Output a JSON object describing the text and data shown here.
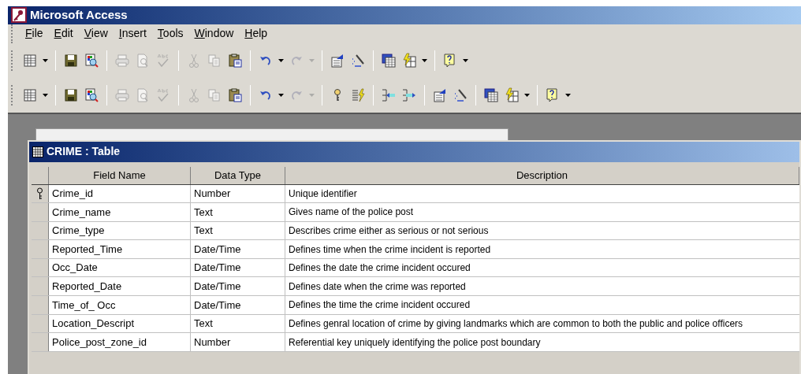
{
  "window": {
    "title": "Microsoft Access"
  },
  "menu": [
    "File",
    "Edit",
    "View",
    "Insert",
    "Tools",
    "Window",
    "Help"
  ],
  "toolbars": [
    [
      {
        "kind": "view",
        "dropdown": true,
        "disabled": false
      },
      {
        "kind": "separator"
      },
      {
        "kind": "save",
        "dropdown": false,
        "disabled": false
      },
      {
        "kind": "file-search",
        "dropdown": false,
        "disabled": false
      },
      {
        "kind": "separator"
      },
      {
        "kind": "print",
        "dropdown": false,
        "disabled": true
      },
      {
        "kind": "preview",
        "dropdown": false,
        "disabled": true
      },
      {
        "kind": "spelling",
        "dropdown": false,
        "disabled": true
      },
      {
        "kind": "separator"
      },
      {
        "kind": "cut",
        "dropdown": false,
        "disabled": true
      },
      {
        "kind": "copy",
        "dropdown": false,
        "disabled": true
      },
      {
        "kind": "paste",
        "dropdown": false,
        "disabled": false
      },
      {
        "kind": "separator"
      },
      {
        "kind": "undo",
        "dropdown": true,
        "disabled": false
      },
      {
        "kind": "redo",
        "dropdown": true,
        "disabled": true
      },
      {
        "kind": "separator"
      },
      {
        "kind": "properties",
        "dropdown": false,
        "disabled": false
      },
      {
        "kind": "build",
        "dropdown": false,
        "disabled": false
      },
      {
        "kind": "separator"
      },
      {
        "kind": "database",
        "dropdown": false,
        "disabled": false
      },
      {
        "kind": "new-object",
        "dropdown": true,
        "disabled": false
      },
      {
        "kind": "separator"
      },
      {
        "kind": "help",
        "dropdown": true,
        "disabled": false
      }
    ],
    [
      {
        "kind": "view",
        "dropdown": true,
        "disabled": false
      },
      {
        "kind": "separator"
      },
      {
        "kind": "save",
        "dropdown": false,
        "disabled": false
      },
      {
        "kind": "file-search",
        "dropdown": false,
        "disabled": false
      },
      {
        "kind": "separator"
      },
      {
        "kind": "print",
        "dropdown": false,
        "disabled": true
      },
      {
        "kind": "preview",
        "dropdown": false,
        "disabled": true
      },
      {
        "kind": "spelling",
        "dropdown": false,
        "disabled": true
      },
      {
        "kind": "separator"
      },
      {
        "kind": "cut",
        "dropdown": false,
        "disabled": true
      },
      {
        "kind": "copy",
        "dropdown": false,
        "disabled": true
      },
      {
        "kind": "paste",
        "dropdown": false,
        "disabled": false
      },
      {
        "kind": "separator"
      },
      {
        "kind": "undo",
        "dropdown": true,
        "disabled": false
      },
      {
        "kind": "redo",
        "dropdown": true,
        "disabled": true
      },
      {
        "kind": "separator"
      },
      {
        "kind": "key",
        "dropdown": false,
        "disabled": false
      },
      {
        "kind": "indexes",
        "dropdown": false,
        "disabled": false
      },
      {
        "kind": "separator"
      },
      {
        "kind": "insert-rows",
        "dropdown": false,
        "disabled": false
      },
      {
        "kind": "delete-rows",
        "dropdown": false,
        "disabled": false
      },
      {
        "kind": "separator"
      },
      {
        "kind": "properties",
        "dropdown": false,
        "disabled": false
      },
      {
        "kind": "build",
        "dropdown": false,
        "disabled": false
      },
      {
        "kind": "separator"
      },
      {
        "kind": "database",
        "dropdown": false,
        "disabled": false
      },
      {
        "kind": "new-object",
        "dropdown": true,
        "disabled": false
      },
      {
        "kind": "separator"
      },
      {
        "kind": "help",
        "dropdown": true,
        "disabled": false
      }
    ]
  ],
  "table_window": {
    "title": "CRIME : Table",
    "columns": [
      "Field Name",
      "Data Type",
      "Description"
    ],
    "rows": [
      {
        "field_name": "Crime_id",
        "data_type": "Number",
        "description": "Unique identifier",
        "primary_key": true
      },
      {
        "field_name": "Crime_name",
        "data_type": "Text",
        "description": "Gives name of the police post",
        "primary_key": false
      },
      {
        "field_name": "Crime_type",
        "data_type": "Text",
        "description": "Describes crime either as serious or not serious",
        "primary_key": false
      },
      {
        "field_name": "Reported_Time",
        "data_type": "Date/Time",
        "description": "Defines time when the crime incident is reported",
        "primary_key": false
      },
      {
        "field_name": "Occ_Date",
        "data_type": "Date/Time",
        "description": "Defines the date the crime incident occured",
        "primary_key": false
      },
      {
        "field_name": "Reported_Date",
        "data_type": "Date/Time",
        "description": "Defines date when the crime was reported",
        "primary_key": false
      },
      {
        "field_name": "Time_of_ Occ",
        "data_type": "Date/Time",
        "description": "Defines the time the crime incident occured",
        "primary_key": false
      },
      {
        "field_name": "Location_Descript",
        "data_type": "Text",
        "description": "Defines genral location of crime by giving landmarks which are common to both the public and police officers",
        "primary_key": false
      },
      {
        "field_name": "Police_post_zone_id",
        "data_type": "Number",
        "description": "Referential key uniquely identifying the police post boundary",
        "primary_key": false
      }
    ]
  }
}
